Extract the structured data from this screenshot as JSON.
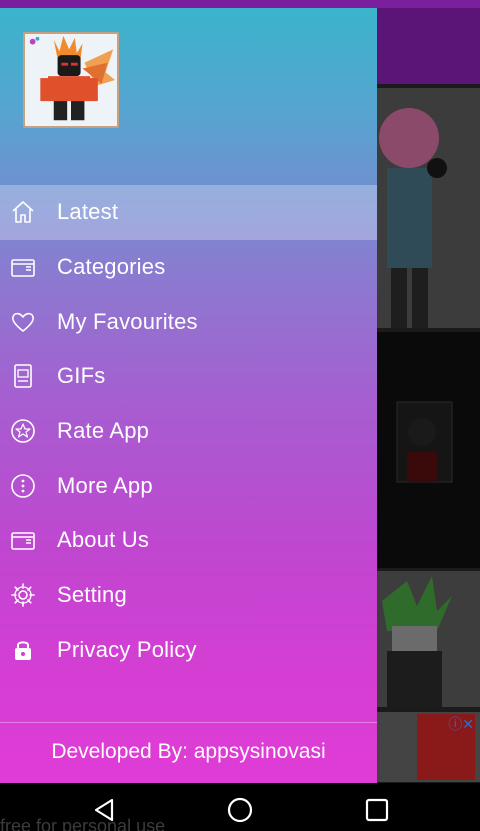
{
  "drawer": {
    "menu": [
      {
        "label": "Latest",
        "icon": "home-icon",
        "active": true
      },
      {
        "label": "Categories",
        "icon": "folder-icon",
        "active": false
      },
      {
        "label": "My Favourites",
        "icon": "heart-icon",
        "active": false
      },
      {
        "label": "GIFs",
        "icon": "gif-file-icon",
        "active": false
      },
      {
        "label": "Rate App",
        "icon": "star-circle-icon",
        "active": false
      },
      {
        "label": "More App",
        "icon": "more-circle-icon",
        "active": false
      },
      {
        "label": "About Us",
        "icon": "folder-icon",
        "active": false
      },
      {
        "label": "Setting",
        "icon": "gear-icon",
        "active": false
      },
      {
        "label": "Privacy Policy",
        "icon": "lock-icon",
        "active": false
      }
    ],
    "footer": "Developed By: appsysinovasi"
  },
  "background": {
    "watermark": "free for personal use"
  },
  "colors": {
    "status_bar": "#7a1f9e",
    "toolbar": "#5b1576",
    "drawer_top": "#3bb4cc",
    "drawer_bottom": "#e03cd6"
  }
}
